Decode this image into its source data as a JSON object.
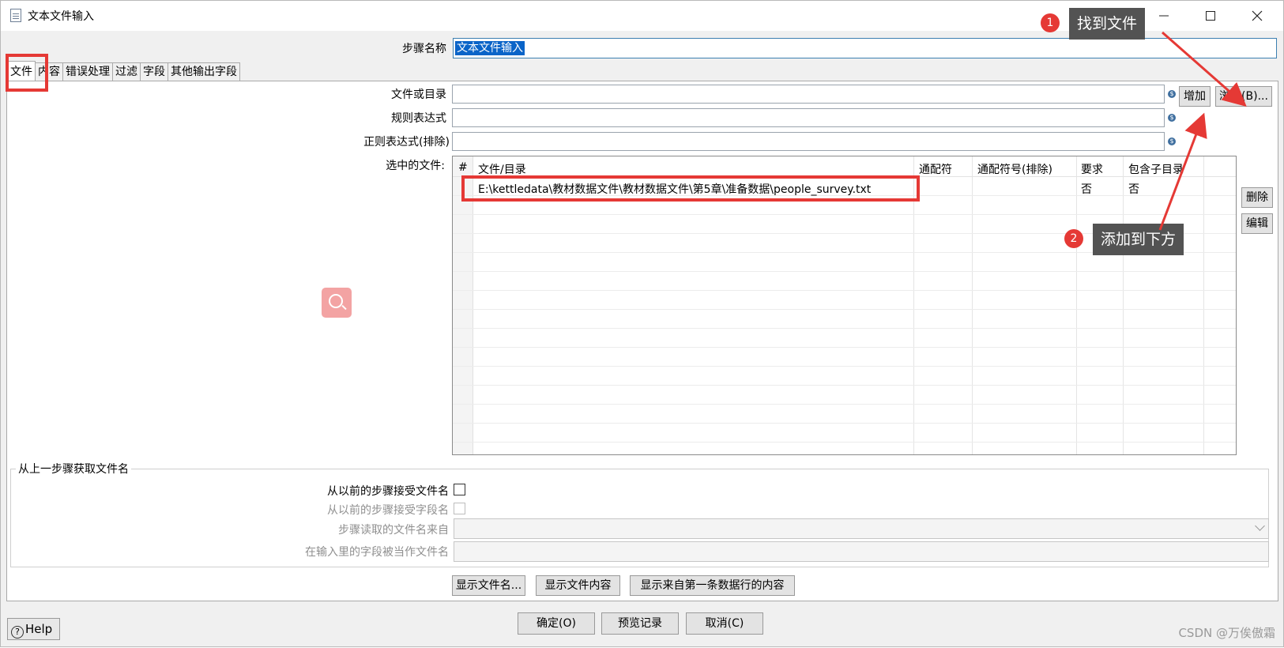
{
  "window": {
    "title": "文本文件输入"
  },
  "step": {
    "label": "步骤名称",
    "value": "文本文件输入"
  },
  "tabs": [
    {
      "label": "文件"
    },
    {
      "label": "内容"
    },
    {
      "label": "错误处理"
    },
    {
      "label": "过滤"
    },
    {
      "label": "字段"
    },
    {
      "label": "其他输出字段"
    }
  ],
  "file_panel": {
    "file_or_dir_label": "文件或目录",
    "regex_label": "规则表达式",
    "regex_exclude_label": "正则表达式(排除)",
    "selected_files_label": "选中的文件:",
    "add_button": "增加",
    "browse_button": "浏览(B)...",
    "delete_button": "删除",
    "edit_button": "编辑",
    "var_icon_glyph": "$"
  },
  "grid": {
    "columns": [
      "#",
      "文件/目录",
      "通配符",
      "通配符号(排除)",
      "要求",
      "包含子目录"
    ],
    "rows": [
      {
        "path": "E:\\kettledata\\教材数据文件\\教材数据文件\\第5章\\准备数据\\people_survey.txt",
        "wildcard": "",
        "wildcard_exclude": "",
        "required": "否",
        "include_subdirs": "否"
      }
    ]
  },
  "from_previous": {
    "group_title": "从上一步骤获取文件名",
    "accept_filenames_label": "从以前的步骤接受文件名",
    "accept_fieldname_label": "从以前的步骤接受字段名",
    "step_read_from_label": "步骤读取的文件名来自",
    "field_as_filename_label": "在输入里的字段被当作文件名"
  },
  "show_buttons": {
    "show_filenames": "显示文件名...",
    "show_file_content": "显示文件内容",
    "show_first_row": "显示来自第一条数据行的内容"
  },
  "footer": {
    "ok": "确定(O)",
    "preview": "预览记录",
    "cancel": "取消(C)",
    "help": "Help"
  },
  "annotations": {
    "callout1_number": "1",
    "callout1_text": "找到文件",
    "callout2_number": "2",
    "callout2_text": "添加到下方",
    "accent_color": "#e53935"
  },
  "watermark": "CSDN @万俟傲霜"
}
